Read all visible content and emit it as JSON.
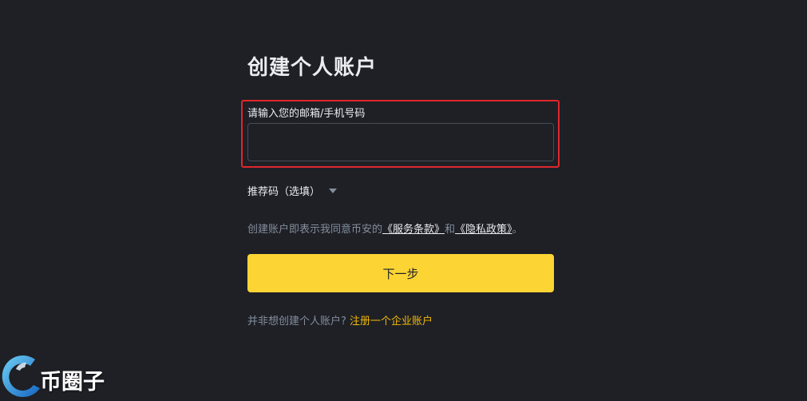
{
  "title": "创建个人账户",
  "email_field": {
    "label": "请输入您的邮箱/手机号码",
    "value": "",
    "placeholder": ""
  },
  "referral": {
    "label": "推荐码（选填）"
  },
  "terms": {
    "prefix": "创建账户即表示我同意币安的",
    "service_link": "《服务条款》",
    "and": "和",
    "privacy_link": "《隐私政策》",
    "suffix": "。"
  },
  "next_button": {
    "label": "下一步"
  },
  "corporate": {
    "prefix": "并非想创建个人账户?",
    "link": "注册一个企业账户"
  },
  "watermark": {
    "text": "币圈子"
  },
  "colors": {
    "background": "#1e2026",
    "accent": "#fcd535",
    "link_accent": "#f0b90b",
    "highlight": "#e0282c"
  },
  "icons": {
    "referral_caret": "caret-down-icon",
    "watermark_logo": "circle-logo-icon"
  }
}
